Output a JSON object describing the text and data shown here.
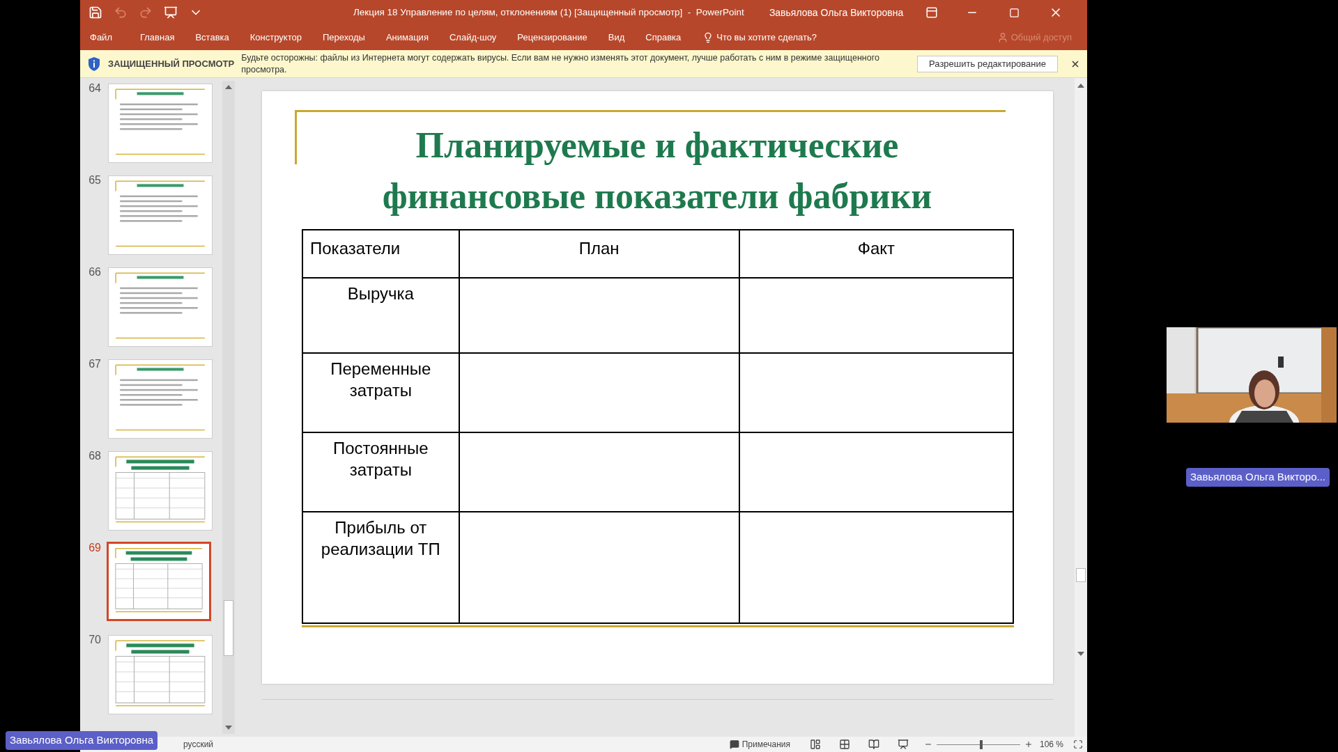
{
  "window": {
    "title": "Лекция 18 Управление по целям, отклонениям (1) [Защищенный просмотр]  -  PowerPoint",
    "user": "Завьялова Ольга Викторовна",
    "quick_access": [
      {
        "kind": "save",
        "disabled": false
      },
      {
        "kind": "undo",
        "disabled": true
      },
      {
        "kind": "redo",
        "disabled": true
      },
      {
        "kind": "present",
        "disabled": false
      },
      {
        "kind": "customize",
        "disabled": false
      }
    ]
  },
  "ribbon_tabs": [
    "Файл",
    "Главная",
    "Вставка",
    "Конструктор",
    "Переходы",
    "Анимация",
    "Слайд-шоу",
    "Рецензирование",
    "Вид",
    "Справка"
  ],
  "tell_me": "Что вы хотите сделать?",
  "share": {
    "label": "Общий доступ",
    "disabled": true
  },
  "protected_view": {
    "label": "ЗАЩИЩЕННЫЙ ПРОСМОТР",
    "message": "Будьте осторожны: файлы из Интернета могут содержать вирусы. Если вам не нужно изменять этот документ, лучше работать с ним в режиме защищенного просмотра.",
    "button": "Разрешить редактирование"
  },
  "thumbnails": [
    {
      "number": "64",
      "kind": "text",
      "selected": false
    },
    {
      "number": "65",
      "kind": "text",
      "selected": false
    },
    {
      "number": "66",
      "kind": "text",
      "selected": false
    },
    {
      "number": "67",
      "kind": "text",
      "selected": false
    },
    {
      "number": "68",
      "kind": "table",
      "selected": false
    },
    {
      "number": "69",
      "kind": "table",
      "selected": true
    },
    {
      "number": "70",
      "kind": "table",
      "selected": false
    }
  ],
  "slide": {
    "title_lines": [
      "Планируемые и фактические",
      "финансовые показатели фабрики"
    ],
    "table": {
      "columns": [
        "Показатели",
        "План",
        "Факт"
      ],
      "rows": [
        [
          "Выручка",
          "",
          ""
        ],
        [
          "Переменные затраты",
          "",
          ""
        ],
        [
          "Постоянные затраты",
          "",
          ""
        ],
        [
          "Прибыль от реализации ТП",
          "",
          ""
        ]
      ]
    }
  },
  "status_bar": {
    "language": "русский",
    "notes": "Примечания",
    "zoom": "106 %",
    "zoom_slider": {
      "level": 0.53
    }
  },
  "video": {
    "name": "Завьялова Ольга Викторо...",
    "overlay_name": "Завьялова Ольга Викторовна"
  }
}
